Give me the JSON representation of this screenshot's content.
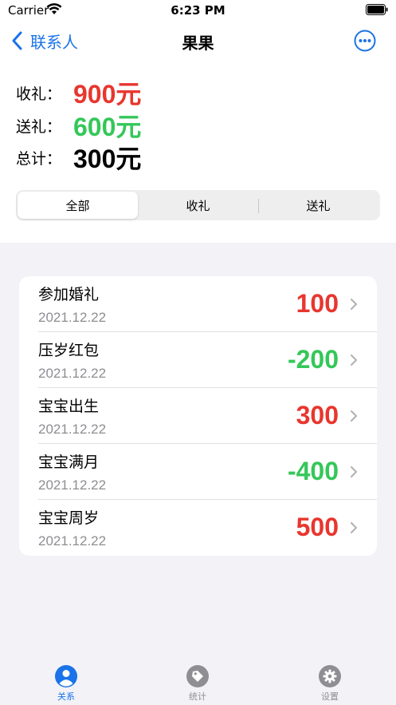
{
  "status_bar": {
    "carrier": "Carrier",
    "time": "6:23 PM"
  },
  "nav": {
    "back_label": "联系人",
    "title": "果果",
    "more_icon": "ellipsis-circle-icon"
  },
  "summary": {
    "received_label": "收礼：",
    "received_value": "900元",
    "sent_label": "送礼：",
    "sent_value": "600元",
    "total_label": "总计：",
    "total_value": "300元"
  },
  "segments": [
    {
      "label": "全部",
      "active": true
    },
    {
      "label": "收礼",
      "active": false
    },
    {
      "label": "送礼",
      "active": false
    }
  ],
  "records": [
    {
      "title": "参加婚礼",
      "date": "2021.12.22",
      "amount": "100",
      "type": "received"
    },
    {
      "title": "压岁红包",
      "date": "2021.12.22",
      "amount": "-200",
      "type": "sent"
    },
    {
      "title": "宝宝出生",
      "date": "2021.12.22",
      "amount": "300",
      "type": "received"
    },
    {
      "title": "宝宝满月",
      "date": "2021.12.22",
      "amount": "-400",
      "type": "sent"
    },
    {
      "title": "宝宝周岁",
      "date": "2021.12.22",
      "amount": "500",
      "type": "received"
    }
  ],
  "tabs": [
    {
      "label": "关系",
      "icon": "person-circle-icon",
      "active": true
    },
    {
      "label": "统计",
      "icon": "tag-circle-icon",
      "active": false
    },
    {
      "label": "设置",
      "icon": "gear-circle-icon",
      "active": false
    }
  ],
  "colors": {
    "accent": "#1a73e8",
    "received": "#e8362e",
    "sent": "#34c759",
    "muted": "#8e8e93"
  }
}
